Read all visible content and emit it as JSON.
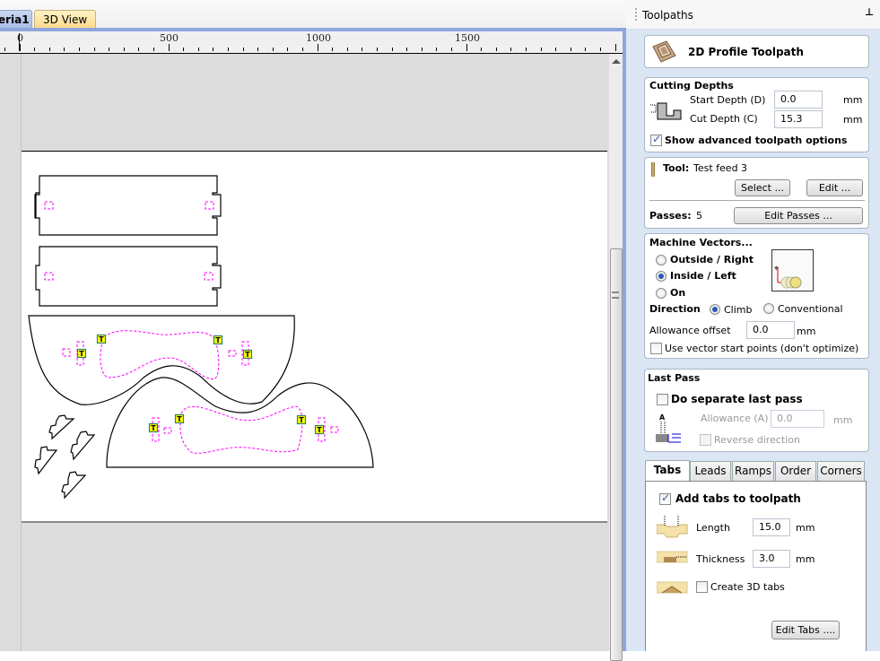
{
  "document_tabs": [
    {
      "label": "eria1",
      "active": true
    },
    {
      "label": "3D View",
      "active": false
    }
  ],
  "ruler": {
    "labels": [
      "0",
      "500",
      "1000",
      "1500"
    ],
    "units": "mm"
  },
  "canvas": {
    "outline_color": "#000000",
    "toolpath_color": "#ff00ff",
    "tab_marker": {
      "label": "T",
      "fill": "#ffff00",
      "border": "#2f7f6f"
    },
    "shapes": [
      "rect-panel-top",
      "rect-panel-bottom",
      "curved-piece-upper",
      "curved-piece-lower",
      "small-notched-piece-1",
      "small-notched-piece-2",
      "small-notched-piece-3",
      "small-notched-piece-4"
    ],
    "tab_count": 8
  },
  "panel": {
    "title": "Toolpaths",
    "pin_icon": "pin-icon",
    "toolpath_title": "2D Profile Toolpath",
    "cutting_depths": {
      "heading": "Cutting Depths",
      "start_label": "Start Depth (D)",
      "start_value": "0.0",
      "cut_label": "Cut Depth (C)",
      "cut_value": "15.3",
      "unit": "mm",
      "advanced_label": "Show advanced toolpath options",
      "advanced_checked": true
    },
    "tool": {
      "label": "Tool:",
      "name": "Test feed 3",
      "select_btn": "Select ...",
      "edit_btn": "Edit ...",
      "passes_label": "Passes:",
      "passes_value": "5",
      "edit_passes_btn": "Edit Passes ..."
    },
    "machine_vectors": {
      "heading": "Machine Vectors...",
      "options": [
        "Outside / Right",
        "Inside / Left",
        "On"
      ],
      "selected": "Inside / Left",
      "direction_label": "Direction",
      "direction_options": [
        "Climb",
        "Conventional"
      ],
      "direction_selected": "Climb",
      "allowance_label": "Allowance offset",
      "allowance_value": "0.0",
      "unit": "mm",
      "start_points_label": "Use vector start points (don't optimize)",
      "start_points_checked": false
    },
    "last_pass": {
      "heading": "Last Pass",
      "separate_label": "Do separate last pass",
      "separate_checked": false,
      "allowance_label": "Allowance (A)",
      "allowance_value": "0.0",
      "unit": "mm",
      "reverse_label": "Reverse direction",
      "reverse_checked": false
    },
    "tabs": [
      "Tabs",
      "Leads",
      "Ramps",
      "Order",
      "Corners"
    ],
    "active_tab": "Tabs",
    "tabs_page": {
      "add_label": "Add tabs to toolpath",
      "add_checked": true,
      "length_label": "Length",
      "length_value": "15.0",
      "thickness_label": "Thickness",
      "thickness_value": "3.0",
      "unit": "mm",
      "create3d_label": "Create 3D tabs",
      "create3d_checked": false,
      "edit_tabs_btn": "Edit Tabs ...."
    }
  }
}
